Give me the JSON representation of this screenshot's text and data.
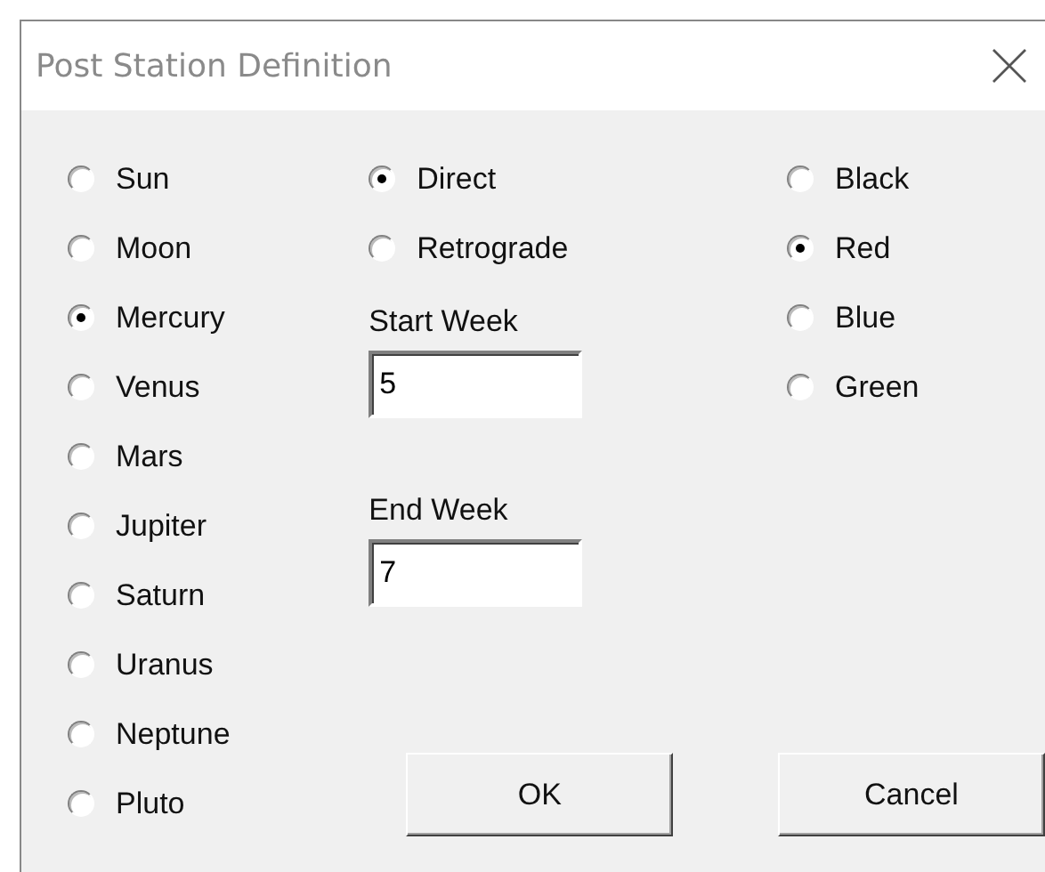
{
  "window": {
    "title": "Post Station Definition"
  },
  "planets": [
    {
      "label": "Sun",
      "selected": false
    },
    {
      "label": "Moon",
      "selected": false
    },
    {
      "label": "Mercury",
      "selected": true
    },
    {
      "label": "Venus",
      "selected": false
    },
    {
      "label": "Mars",
      "selected": false
    },
    {
      "label": "Jupiter",
      "selected": false
    },
    {
      "label": "Saturn",
      "selected": false
    },
    {
      "label": "Uranus",
      "selected": false
    },
    {
      "label": "Neptune",
      "selected": false
    },
    {
      "label": "Pluto",
      "selected": false
    }
  ],
  "motion": [
    {
      "label": "Direct",
      "selected": true
    },
    {
      "label": "Retrograde",
      "selected": false
    }
  ],
  "start_week": {
    "label": "Start Week",
    "value": "5"
  },
  "end_week": {
    "label": "End Week",
    "value": "7"
  },
  "colors": [
    {
      "label": "Black",
      "selected": false
    },
    {
      "label": "Red",
      "selected": true
    },
    {
      "label": "Blue",
      "selected": false
    },
    {
      "label": "Green",
      "selected": false
    }
  ],
  "buttons": [
    {
      "label": "OK"
    },
    {
      "label": "Cancel"
    }
  ]
}
